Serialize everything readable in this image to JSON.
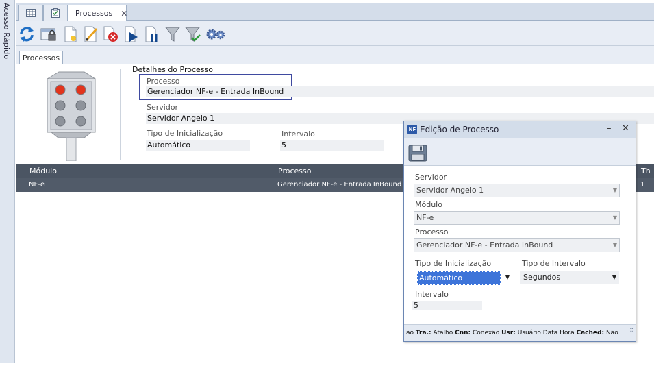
{
  "sidebar": {
    "label": "Acesso Rápido"
  },
  "tabs": [
    {
      "label": "",
      "icon": "grid-icon"
    },
    {
      "label": "",
      "icon": "checklist-icon"
    },
    {
      "label": "Processos",
      "icon": ""
    }
  ],
  "toolbar": {
    "icons": [
      "refresh-icon",
      "lock-window-icon",
      "new-document-icon",
      "edit-pencil-icon",
      "delete-icon",
      "play-icon",
      "pause-icon",
      "filter-icon",
      "filter-clear-icon",
      "settings-gears-icon"
    ]
  },
  "subtab": {
    "label": "Processos"
  },
  "details": {
    "title": "Detalhes do Processo",
    "processo_label": "Processo",
    "processo_value": "Gerenciador NF-e - Entrada InBound",
    "servidor_label": "Servidor",
    "servidor_value": "Servidor Angelo 1",
    "tipo_label": "Tipo de Inicialização",
    "tipo_value": "Automático",
    "intervalo_label": "Intervalo",
    "intervalo_value": "5"
  },
  "grid": {
    "columns": [
      "Módulo",
      "Processo",
      "Th"
    ],
    "rows": [
      {
        "modulo": "NF-e",
        "processo": "Gerenciador NF-e - Entrada InBound",
        "th": "1"
      }
    ]
  },
  "dialog": {
    "title": "Edição de Processo",
    "servidor_label": "Servidor",
    "servidor_value": "Servidor Angelo 1",
    "modulo_label": "Módulo",
    "modulo_value": "NF-e",
    "processo_label": "Processo",
    "processo_value": "Gerenciador NF-e - Entrada InBound",
    "tipo_inicializacao_label": "Tipo de Inicialização",
    "tipo_inicializacao_value": "Automático",
    "tipo_intervalo_label": "Tipo de Intervalo",
    "tipo_intervalo_value": "Segundos",
    "intervalo_label": "Intervalo",
    "intervalo_value": "5",
    "status": {
      "prefix": "ão",
      "tra_key": "Tra.:",
      "tra_val": "Atalho",
      "cnn_key": "Cnn:",
      "cnn_val": "Conexão",
      "usr_key": "Usr:",
      "usr_val": "Usuário",
      "datahora": "Data Hora",
      "cached_key": "Cached:",
      "cached_val": "Não"
    }
  },
  "colors": {
    "highlight_border": "#3f4aa0",
    "grid_header": "#4b5563",
    "grid_row": "#515b69",
    "selection": "#3d74d9"
  }
}
